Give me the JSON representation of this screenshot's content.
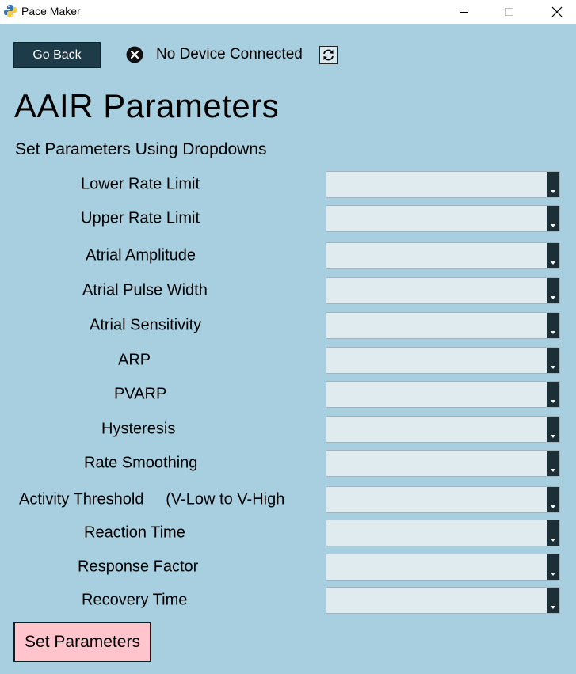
{
  "window": {
    "title": "Pace Maker"
  },
  "header": {
    "go_back_label": "Go Back",
    "status_text": "No Device Connected",
    "status_icon": "close-circle-icon",
    "refresh_icon": "refresh-icon"
  },
  "main": {
    "title": "AAIR Parameters",
    "subtitle": "Set Parameters Using Dropdowns",
    "parameters": [
      {
        "label": "Lower Rate Limit",
        "value": ""
      },
      {
        "label": "Upper Rate Limit",
        "value": ""
      },
      {
        "label": "Atrial Amplitude",
        "value": ""
      },
      {
        "label": "Atrial Pulse Width",
        "value": ""
      },
      {
        "label": "Atrial Sensitivity",
        "value": ""
      },
      {
        "label": "ARP",
        "value": ""
      },
      {
        "label": "PVARP",
        "value": ""
      },
      {
        "label": "Hysteresis",
        "value": ""
      },
      {
        "label": "Rate Smoothing",
        "value": ""
      },
      {
        "label": "Activity Threshold     (V-Low to V-High",
        "value": ""
      },
      {
        "label": "Reaction Time",
        "value": ""
      },
      {
        "label": "Response Factor",
        "value": ""
      },
      {
        "label": "Recovery Time",
        "value": ""
      }
    ],
    "submit_label": "Set Parameters"
  },
  "colors": {
    "background": "#a8cfdf",
    "go_back_bg": "#1e3b4a",
    "submit_bg": "#ffc4cc",
    "dropdown_bg": "#e0ebf0"
  }
}
